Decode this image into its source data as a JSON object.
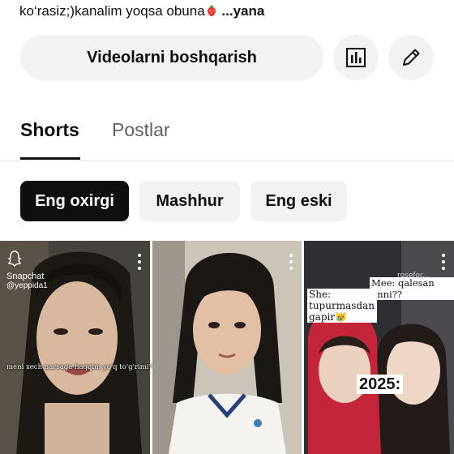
{
  "channel": {
    "description": "ko‘rasiz;)kanalim yoqsa obuna",
    "more_label": "...yana",
    "manage_videos_label": "Videolarni boshqarish"
  },
  "tabs": [
    {
      "label": "Shorts",
      "active": true
    },
    {
      "label": "Postlar",
      "active": false
    }
  ],
  "filters": [
    {
      "label": "Eng oxirgi",
      "selected": true
    },
    {
      "label": "Mashhur",
      "selected": false
    },
    {
      "label": "Eng eski",
      "selected": false
    }
  ],
  "shorts": [
    {
      "snapchat_label": "Snapchat",
      "snapchat_user": "@yeppida1",
      "caption": "meni xech narsaga haqqim yo'q to'g'rimi?"
    },
    {
      "caption": ""
    },
    {
      "caption_left": "She: tupurmasdan gapir😿",
      "caption_right": "Mee: qalesan jinni??",
      "year_label": "2025:"
    }
  ],
  "icons": {
    "stats": "bar-chart-icon",
    "edit": "pencil-icon",
    "more": "more-vert-icon"
  }
}
